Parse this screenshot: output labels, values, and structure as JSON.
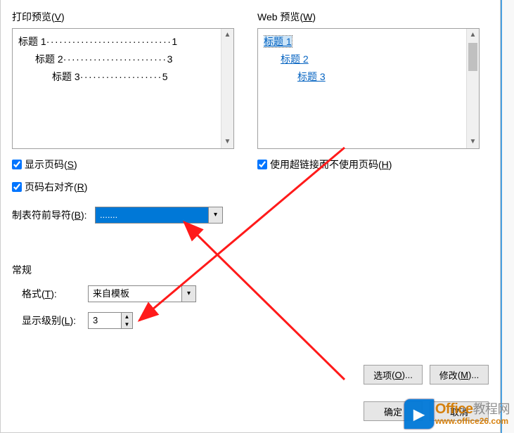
{
  "printPreview": {
    "label": "打印预览",
    "accel": "V",
    "lines": [
      {
        "text": "标题 1",
        "page": "1",
        "indent": 0
      },
      {
        "text": "标题 2",
        "page": "3",
        "indent": 1
      },
      {
        "text": "标题 3",
        "page": "5",
        "indent": 2
      }
    ]
  },
  "webPreview": {
    "label": "Web 预览",
    "accel": "W",
    "links": [
      {
        "text": "标题 1",
        "indent": 0,
        "selected": true
      },
      {
        "text": "标题 2",
        "indent": 1,
        "selected": false
      },
      {
        "text": "标题 3",
        "indent": 2,
        "selected": false
      }
    ]
  },
  "checks": {
    "showPage": {
      "label": "显示页码",
      "accel": "S",
      "checked": true
    },
    "rightAlign": {
      "label": "页码右对齐",
      "accel": "R",
      "checked": true
    },
    "useHyperlink": {
      "label": "使用超链接而不使用页码",
      "accel": "H",
      "checked": true
    }
  },
  "tabLeader": {
    "label": "制表符前导符",
    "accel": "B",
    "value": "......."
  },
  "general": {
    "title": "常规",
    "format": {
      "label": "格式",
      "accel": "T",
      "value": "来自模板"
    },
    "showLevels": {
      "label": "显示级别",
      "accel": "L",
      "value": "3"
    }
  },
  "buttons": {
    "options": {
      "label": "选项",
      "accel": "O",
      "suffix": "..."
    },
    "modify": {
      "label": "修改",
      "accel": "M",
      "suffix": "..."
    },
    "ok": "确定",
    "cancel": "取消"
  },
  "watermark": {
    "brand1": "Office",
    "brand2": "教程网",
    "url": "www.office26.com"
  }
}
